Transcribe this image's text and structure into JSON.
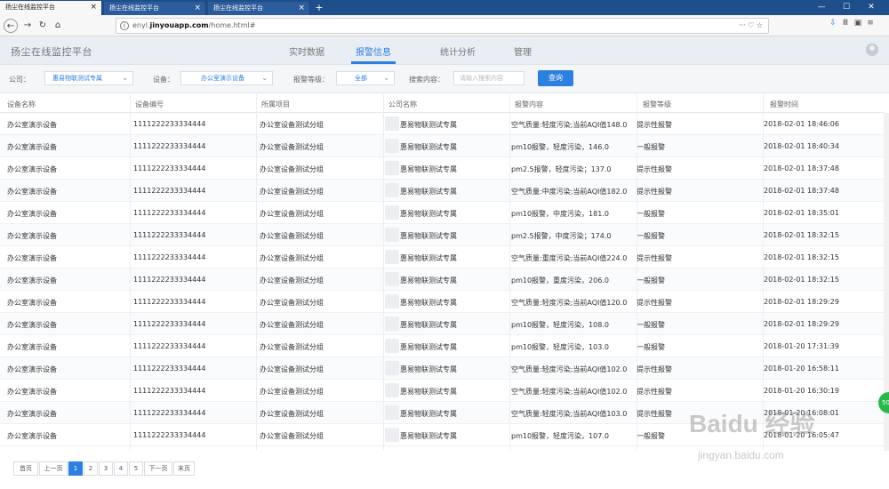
{
  "browser": {
    "tabs": [
      {
        "title": "扬尘在线监控平台",
        "active": true
      },
      {
        "title": "扬尘在线监控平台",
        "active": false
      },
      {
        "title": "扬尘在线监控平台",
        "active": false
      }
    ],
    "new_tab": "+",
    "url_host": "enyl.",
    "url_domain": "jinyouapp.com",
    "url_path": "/home.html#",
    "url_icons": "··· ♡ ☆",
    "window_buttons": [
      "—",
      "☐",
      "✕"
    ]
  },
  "app": {
    "brand": "扬尘在线监控平台",
    "nav": [
      {
        "label": "实时数据",
        "active": false
      },
      {
        "label": "报警信息",
        "active": true
      },
      {
        "label": "统计分析",
        "active": false
      },
      {
        "label": "管理",
        "active": false
      }
    ]
  },
  "filter": {
    "company_label": "公司：",
    "company_value": "惠易物联测试专属",
    "device_label": "设备：",
    "device_value": "办公室演示设备",
    "level_label": "报警等级：",
    "level_value": "全部",
    "search_label": "搜索内容：",
    "search_placeholder": "请输入搜索内容",
    "query_button": "查询"
  },
  "table": {
    "headers": [
      "设备名称",
      "设备编号",
      "所属项目",
      "公司名称",
      "报警内容",
      "报警等级",
      "报警时间"
    ],
    "rows": [
      [
        "办公室演示设备",
        "1111222233334444",
        "办公室设备测试分组",
        "惠易物联测试专属",
        "空气质量:轻度污染;当前AQI值148.0",
        "提示性报警",
        "2018-02-01 18:46:06"
      ],
      [
        "办公室演示设备",
        "1111222233334444",
        "办公室设备测试分组",
        "惠易物联测试专属",
        "pm10报警，轻度污染，146.0",
        "一般报警",
        "2018-02-01 18:40:34"
      ],
      [
        "办公室演示设备",
        "1111222233334444",
        "办公室设备测试分组",
        "惠易物联测试专属",
        "pm2.5报警，轻度污染；137.0",
        "提示性报警",
        "2018-02-01 18:37:48"
      ],
      [
        "办公室演示设备",
        "1111222233334444",
        "办公室设备测试分组",
        "惠易物联测试专属",
        "空气质量:中度污染;当前AQI值182.0",
        "提示性报警",
        "2018-02-01 18:37:48"
      ],
      [
        "办公室演示设备",
        "1111222233334444",
        "办公室设备测试分组",
        "惠易物联测试专属",
        "pm10报警，中度污染，181.0",
        "一般报警",
        "2018-02-01 18:35:01"
      ],
      [
        "办公室演示设备",
        "1111222233334444",
        "办公室设备测试分组",
        "惠易物联测试专属",
        "pm2.5报警，中度污染；174.0",
        "一般报警",
        "2018-02-01 18:32:15"
      ],
      [
        "办公室演示设备",
        "1111222233334444",
        "办公室设备测试分组",
        "惠易物联测试专属",
        "空气质量:重度污染;当前AQI值224.0",
        "提示性报警",
        "2018-02-01 18:32:15"
      ],
      [
        "办公室演示设备",
        "1111222233334444",
        "办公室设备测试分组",
        "惠易物联测试专属",
        "pm10报警，重度污染，206.0",
        "一般报警",
        "2018-02-01 18:32:15"
      ],
      [
        "办公室演示设备",
        "1111222233334444",
        "办公室设备测试分组",
        "惠易物联测试专属",
        "空气质量:轻度污染;当前AQI值120.0",
        "提示性报警",
        "2018-02-01 18:29:29"
      ],
      [
        "办公室演示设备",
        "1111222233334444",
        "办公室设备测试分组",
        "惠易物联测试专属",
        "pm10报警，轻度污染，108.0",
        "一般报警",
        "2018-02-01 18:29:29"
      ],
      [
        "办公室演示设备",
        "1111222233334444",
        "办公室设备测试分组",
        "惠易物联测试专属",
        "pm10报警，轻度污染，103.0",
        "一般报警",
        "2018-01-20 17:31:39"
      ],
      [
        "办公室演示设备",
        "1111222233334444",
        "办公室设备测试分组",
        "惠易物联测试专属",
        "空气质量:轻度污染;当前AQI值102.0",
        "提示性报警",
        "2018-01-20 16:58:11"
      ],
      [
        "办公室演示设备",
        "1111222233334444",
        "办公室设备测试分组",
        "惠易物联测试专属",
        "空气质量:轻度污染;当前AQI值102.0",
        "提示性报警",
        "2018-01-20 16:30:19"
      ],
      [
        "办公室演示设备",
        "1111222233334444",
        "办公室设备测试分组",
        "惠易物联测试专属",
        "空气质量:轻度污染;当前AQI值103.0",
        "提示性报警",
        "2018-01-20 16:08:01"
      ],
      [
        "办公室演示设备",
        "1111222233334444",
        "办公室设备测试分组",
        "惠易物联测试专属",
        "pm10报警，轻度污染，107.0",
        "一般报警",
        "2018-01-20 16:05:47"
      ]
    ]
  },
  "pager": {
    "items": [
      "首页",
      "上一页",
      "1",
      "2",
      "3",
      "4",
      "5",
      "下一页",
      "末页"
    ],
    "active": "1"
  },
  "badge": "50",
  "watermark": {
    "line1": "Baidu 经验",
    "line2": "jingyan.baidu.com"
  },
  "colors": {
    "accent": "#2d7fe0",
    "tabbar": "#1f4e8c"
  }
}
